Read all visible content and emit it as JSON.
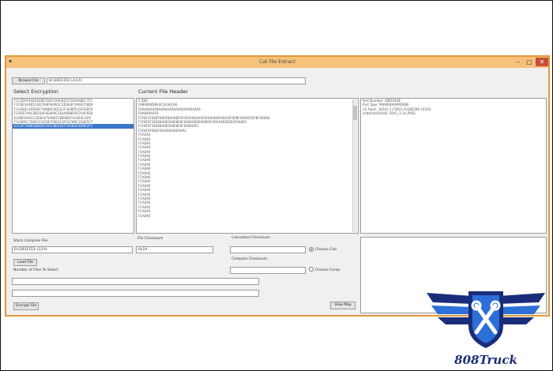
{
  "window": {
    "title": "Cat File Extract"
  },
  "toolbar": {
    "browse_file_label": "Browse File",
    "file_path": "D:\\2831153 v13.fs"
  },
  "encryption": {
    "heading": "Select Encryption",
    "items": [
      "F1C5D0F4AE01EBE7D4F2A9C8E1F5D4AA8EC7F2",
      "F1C0E3A4B5C6D7E8F9A0B1C2D3E4F5A6B7C8D9",
      "F1A2B3C4D5E6F7A8B9C0D1E2F3A4B5C6D7E8F9",
      "F1D5E7A9C0B2D4F6E8A0C2E4A6B8D0F2A4C6E8",
      "E1B8F0AA1C2D3E4F5A6B7C8D9E0F1A2B3C4D5",
      "F1A3B5C7D9E1F3A5B7C9D1E3F5A7B9C1D3E5F7",
      "E1C4F7A0B3D6E9F2A5C8D1E4F7A0B3C6D9E2F5"
    ],
    "selected_index": 6
  },
  "header": {
    "heading": "Current File Header",
    "lines": [
      "F:\\DEF",
      "F6808E8D9E4C3A3A1A0",
      "F6A0A6A4A6A4A6A4A0A4A6A0A6A4A6",
      "F6A0A6A4F8",
      "F1F8F1F0E8F0A0F8A0A8F0F0A0A0A0A0F8F0A0E8F0A0A0F0E8F0A0A0F0F8F0A0E8",
      "F1F8F0F1E0E8A0E0A0E8E0F0A0A0E0E0A0E0F0A0A0E0E0E0F0A0E0",
      "F1F8F0F1E0E8A0E0A0E8E0F0A0E0A0",
      "F1F8F0F0E8F0A0A0A0A0A0A1",
      "F1A0A0",
      "F1A0A0",
      "F1A0A0",
      "F1A0A0",
      "F1A0A0",
      "F1A0A0",
      "F1A0A0",
      "F1A0A0",
      "F1A0A0",
      "F1A0A0",
      "F1A0A0",
      "F1A0A0",
      "F1A0A0",
      "F1A0A0",
      "F1A0A0",
      "F1A0A0",
      "F1A0A0",
      "F1A0A0",
      "F1A0A0",
      "F1A0A0"
    ]
  },
  "info": {
    "lines": [
      "Part Number: 3891910E",
      "Part Type: PARKR8AVAMQR8E",
      "CS Flash: 3A5A1.1.F0931.0318E29R 16316",
      "chdr6ckd18180: F8V1_3.14_PR81"
    ]
  },
  "bottom": {
    "stock_compare_label": "Stock Compare File",
    "stock_compare_value": "D:\\2831153 v13.fs",
    "load_file_label": "Load File",
    "num_files_label": "Number of Files To Select",
    "encrypt_file_label": "Encrypt File",
    "file_checksum_label": "File Checksum",
    "file_checksum_value": "0x1A",
    "calc_checksum_label": "Calculated Checksum",
    "calc_checksum_value": "",
    "choose_calc_label": "Choose Calc",
    "compare_checksum_label": "Compare Checksum",
    "compare_checksum_value": "",
    "choose_comp_label": "Choose Comp",
    "view_map_label": "View Map"
  },
  "watermark": {
    "text": "808Truck",
    "colors": {
      "navy": "#1a2d7a",
      "blue": "#2c6fd8"
    }
  }
}
